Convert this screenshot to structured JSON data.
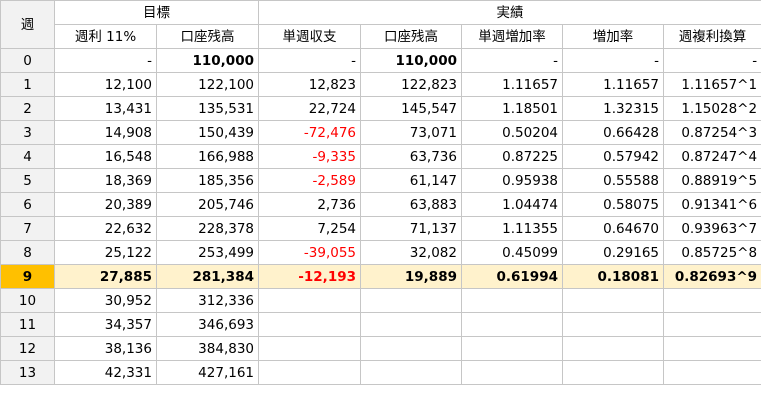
{
  "header": {
    "week_label": "週",
    "group_target": "目標",
    "group_actual": "実績",
    "columns": [
      "週利 11%",
      "口座残高",
      "単週収支",
      "口座残高",
      "単週増加率",
      "増加率",
      "週複利換算"
    ]
  },
  "rows": [
    {
      "week": "0",
      "target_weekly": "-",
      "target_balance": "110,000",
      "weekly_pl": "-",
      "actual_balance": "110,000",
      "weekly_rate": "-",
      "growth_rate": "-",
      "compound": "-"
    },
    {
      "week": "1",
      "target_weekly": "12,100",
      "target_balance": "122,100",
      "weekly_pl": "12,823",
      "actual_balance": "122,823",
      "weekly_rate": "1.11657",
      "growth_rate": "1.11657",
      "compound": "1.11657^1"
    },
    {
      "week": "2",
      "target_weekly": "13,431",
      "target_balance": "135,531",
      "weekly_pl": "22,724",
      "actual_balance": "145,547",
      "weekly_rate": "1.18501",
      "growth_rate": "1.32315",
      "compound": "1.15028^2"
    },
    {
      "week": "3",
      "target_weekly": "14,908",
      "target_balance": "150,439",
      "weekly_pl": "-72,476",
      "actual_balance": "73,071",
      "weekly_rate": "0.50204",
      "growth_rate": "0.66428",
      "compound": "0.87254^3"
    },
    {
      "week": "4",
      "target_weekly": "16,548",
      "target_balance": "166,988",
      "weekly_pl": "-9,335",
      "actual_balance": "63,736",
      "weekly_rate": "0.87225",
      "growth_rate": "0.57942",
      "compound": "0.87247^4"
    },
    {
      "week": "5",
      "target_weekly": "18,369",
      "target_balance": "185,356",
      "weekly_pl": "-2,589",
      "actual_balance": "61,147",
      "weekly_rate": "0.95938",
      "growth_rate": "0.55588",
      "compound": "0.88919^5"
    },
    {
      "week": "6",
      "target_weekly": "20,389",
      "target_balance": "205,746",
      "weekly_pl": "2,736",
      "actual_balance": "63,883",
      "weekly_rate": "1.04474",
      "growth_rate": "0.58075",
      "compound": "0.91341^6"
    },
    {
      "week": "7",
      "target_weekly": "22,632",
      "target_balance": "228,378",
      "weekly_pl": "7,254",
      "actual_balance": "71,137",
      "weekly_rate": "1.11355",
      "growth_rate": "0.64670",
      "compound": "0.93963^7"
    },
    {
      "week": "8",
      "target_weekly": "25,122",
      "target_balance": "253,499",
      "weekly_pl": "-39,055",
      "actual_balance": "32,082",
      "weekly_rate": "0.45099",
      "growth_rate": "0.29165",
      "compound": "0.85725^8"
    },
    {
      "week": "9",
      "target_weekly": "27,885",
      "target_balance": "281,384",
      "weekly_pl": "-12,193",
      "actual_balance": "19,889",
      "weekly_rate": "0.61994",
      "growth_rate": "0.18081",
      "compound": "0.82693^9"
    },
    {
      "week": "10",
      "target_weekly": "30,952",
      "target_balance": "312,336",
      "weekly_pl": "",
      "actual_balance": "",
      "weekly_rate": "",
      "growth_rate": "",
      "compound": ""
    },
    {
      "week": "11",
      "target_weekly": "34,357",
      "target_balance": "346,693",
      "weekly_pl": "",
      "actual_balance": "",
      "weekly_rate": "",
      "growth_rate": "",
      "compound": ""
    },
    {
      "week": "12",
      "target_weekly": "38,136",
      "target_balance": "384,830",
      "weekly_pl": "",
      "actual_balance": "",
      "weekly_rate": "",
      "growth_rate": "",
      "compound": ""
    },
    {
      "week": "13",
      "target_weekly": "42,331",
      "target_balance": "427,161",
      "weekly_pl": "",
      "actual_balance": "",
      "weekly_rate": "",
      "growth_rate": "",
      "compound": ""
    }
  ],
  "current_week": "9",
  "colors": {
    "negative": "#ff0000",
    "current_row_bg": "#fff2cc",
    "current_week_bg": "#ffc000",
    "header_bg": "#f2f2f2",
    "grid": "#c6c6c6"
  }
}
